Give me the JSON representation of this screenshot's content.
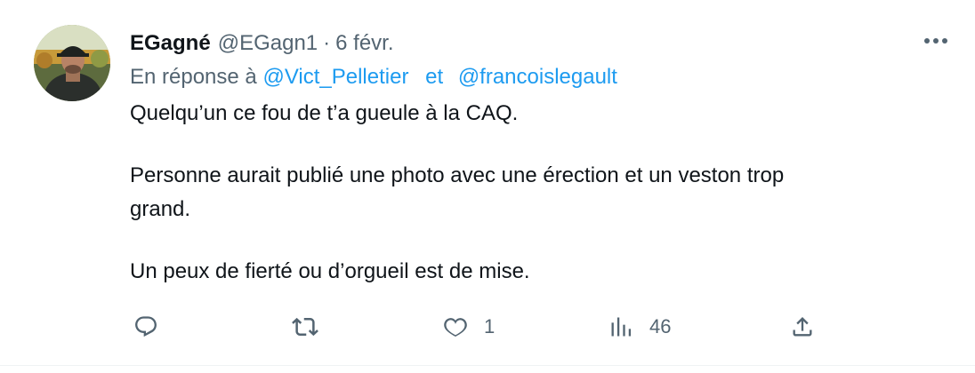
{
  "tweet": {
    "author_name": "EGagné",
    "author_handle": "@EGagn1",
    "separator": "·",
    "date": "6 févr.",
    "reply_prefix": "En réponse à",
    "reply_mentions": [
      "@Vict_Pelletier",
      "@francoislegault"
    ],
    "reply_conjunction": "et",
    "text_lines": [
      "Quelqu’un ce fou de t’a gueule à la CAQ.",
      "Personne aurait publié une photo avec une érection et un veston trop",
      "grand.",
      "Un peux de fierté ou d’orgueil est de mise."
    ]
  },
  "actions": {
    "reply": {
      "icon": "reply-icon",
      "count": ""
    },
    "retweet": {
      "icon": "retweet-icon",
      "count": ""
    },
    "like": {
      "icon": "heart-icon",
      "count": "1"
    },
    "views": {
      "icon": "views-icon",
      "count": "46"
    },
    "share": {
      "icon": "share-icon",
      "count": ""
    }
  },
  "more_menu": {
    "icon": "more-icon"
  },
  "colors": {
    "text": "#0f1419",
    "secondary": "#536471",
    "link": "#1d9bf0",
    "background": "#ffffff"
  }
}
